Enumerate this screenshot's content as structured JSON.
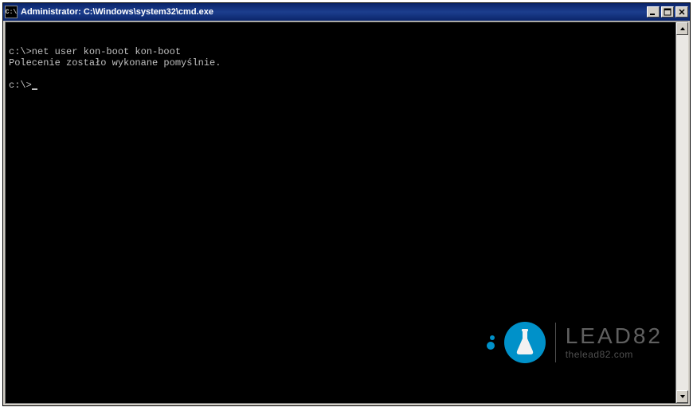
{
  "window": {
    "title": "Administrator: C:\\Windows\\system32\\cmd.exe",
    "icon_label": "C:\\"
  },
  "console": {
    "line1": "c:\\>net user kon-boot kon-boot",
    "line2": "Polecenie zostało wykonane pomyślnie.",
    "line3": "",
    "prompt": "c:\\>"
  },
  "watermark": {
    "brand": "LEAD82",
    "url": "thelead82.com"
  }
}
